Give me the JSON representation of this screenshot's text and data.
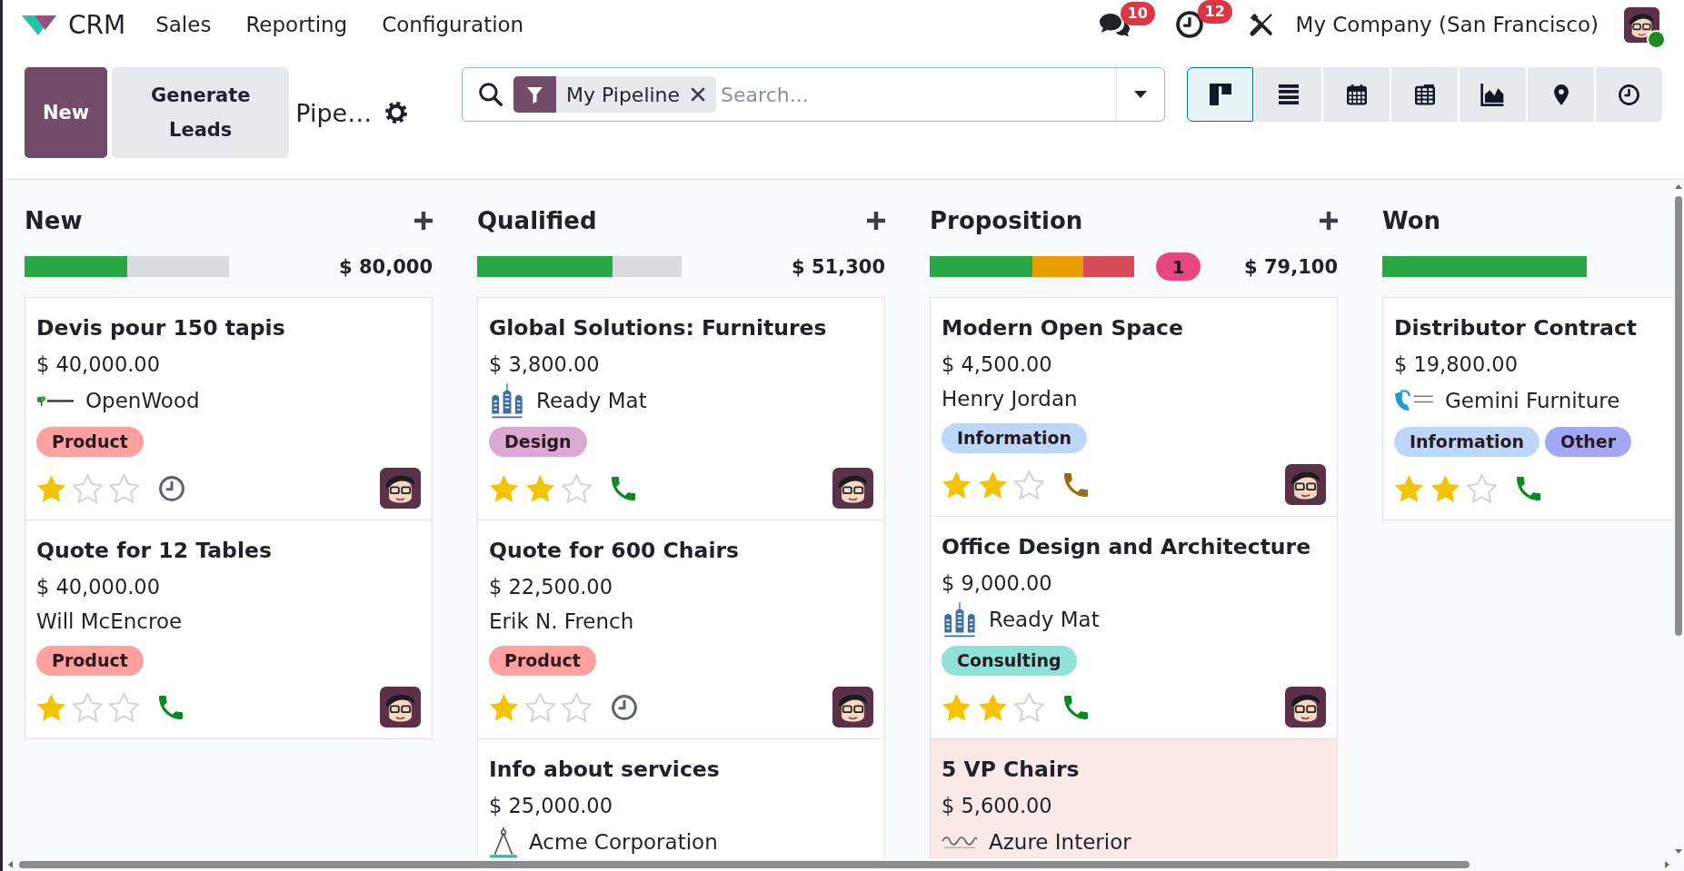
{
  "navbar": {
    "app_name": "CRM",
    "menus": [
      "Sales",
      "Reporting",
      "Configuration"
    ],
    "systray": [
      {
        "kind": "chat",
        "badge": "10"
      },
      {
        "kind": "activity",
        "badge": "12"
      },
      {
        "kind": "tools"
      }
    ],
    "company": "My Company (San Francisco)",
    "user": {
      "online": true
    }
  },
  "control_panel": {
    "buttons": [
      {
        "label": "New",
        "kind": "primary"
      },
      {
        "label": "Generate Leads",
        "kind": "secondary"
      }
    ],
    "breadcrumb": "Pipe…",
    "search": {
      "facets": [
        {
          "label": "My Pipeline"
        }
      ],
      "placeholder": "Search..."
    },
    "views": [
      {
        "kind": "kanban",
        "selected": true
      },
      {
        "kind": "list",
        "selected": false
      },
      {
        "kind": "calendar",
        "selected": false
      },
      {
        "kind": "pivot",
        "selected": false
      },
      {
        "kind": "graph",
        "selected": false
      },
      {
        "kind": "map",
        "selected": false
      },
      {
        "kind": "activity",
        "selected": false
      }
    ]
  },
  "columns": [
    {
      "title": "New",
      "add": true,
      "progress": [
        {
          "color": "#28a745",
          "level": 0.5
        }
      ],
      "total": "$ 80,000",
      "cards": [
        {
          "title": "Devis pour 150 tapis",
          "amount": "$ 40,000.00",
          "customer": "OpenWood",
          "logo": {
            "kind": "tree"
          },
          "tags": [
            {
              "label": "Product",
              "color": "#ff9f9f"
            }
          ],
          "stars": 1,
          "activity": {
            "kind": "clock",
            "color": "#5f636f"
          },
          "avatar": true,
          "highlighted": false
        },
        {
          "title": "Quote for 12 Tables",
          "amount": "$ 40,000.00",
          "customer": "Will McEncroe",
          "tags": [
            {
              "label": "Product",
              "color": "#ff9f9f"
            }
          ],
          "stars": 1,
          "activity": {
            "kind": "phone",
            "color": "#0a8a1e"
          },
          "avatar": true,
          "highlighted": false
        }
      ]
    },
    {
      "title": "Qualified",
      "add": true,
      "progress": [
        {
          "color": "#28a745",
          "level": 0.66
        }
      ],
      "total": "$ 51,300",
      "cards": [
        {
          "title": "Global Solutions: Furnitures",
          "amount": "$ 3,800.00",
          "customer": "Ready Mat",
          "logo": {
            "kind": "buildings"
          },
          "tags": [
            {
              "label": "Design",
              "color": "#dba8d3"
            }
          ],
          "stars": 2,
          "activity": {
            "kind": "phone",
            "color": "#0a8a1e"
          },
          "avatar": true,
          "highlighted": false
        },
        {
          "title": "Quote for 600 Chairs",
          "amount": "$ 22,500.00",
          "customer": "Erik N. French",
          "tags": [
            {
              "label": "Product",
              "color": "#ff9f9f"
            }
          ],
          "stars": 1,
          "activity": {
            "kind": "clock",
            "color": "#5f636f"
          },
          "avatar": true,
          "highlighted": false
        },
        {
          "title": "Info about services",
          "amount": "$ 25,000.00",
          "customer": "Acme Corporation",
          "logo": {
            "kind": "compass"
          },
          "avatar": false,
          "highlighted": false
        }
      ]
    },
    {
      "title": "Proposition",
      "add": true,
      "progress": [
        {
          "color": "#28a745",
          "level": 0.5
        },
        {
          "color": "#e99d00",
          "level": 0.25
        },
        {
          "color": "#d44c59",
          "level": 0.25
        }
      ],
      "counter": "1",
      "total": "$ 79,100",
      "cards": [
        {
          "title": "Modern Open Space",
          "amount": "$ 4,500.00",
          "customer": "Henry Jordan",
          "tags": [
            {
              "label": "Information",
              "color": "#bcd7f7"
            }
          ],
          "stars": 2,
          "activity": {
            "kind": "phone",
            "color": "#9a6a0e"
          },
          "avatar": true,
          "highlighted": false
        },
        {
          "title": "Office Design and Architecture",
          "amount": "$ 9,000.00",
          "customer": "Ready Mat",
          "logo": {
            "kind": "buildings"
          },
          "tags": [
            {
              "label": "Consulting",
              "color": "#8fe1d9"
            }
          ],
          "stars": 2,
          "activity": {
            "kind": "phone",
            "color": "#0a8a1e"
          },
          "avatar": true,
          "highlighted": false
        },
        {
          "title": "5 VP Chairs",
          "amount": "$ 5,600.00",
          "customer": "Azure Interior",
          "logo": {
            "kind": "wave"
          },
          "avatar": false,
          "highlighted": true
        }
      ]
    },
    {
      "title": "Won",
      "add": false,
      "progress": [
        {
          "color": "#28a745",
          "level": 1
        }
      ],
      "cards": [
        {
          "title": "Distributor Contract",
          "amount": "$ 19,800.00",
          "customer": "Gemini Furniture",
          "logo": {
            "kind": "chair"
          },
          "tags": [
            {
              "label": "Information",
              "color": "#bcd7f7"
            },
            {
              "label": "Other",
              "color": "#a3a8f6"
            }
          ],
          "stars": 2,
          "activity": {
            "kind": "phone",
            "color": "#0a8a1e"
          },
          "avatar": false,
          "highlighted": false
        }
      ]
    }
  ]
}
